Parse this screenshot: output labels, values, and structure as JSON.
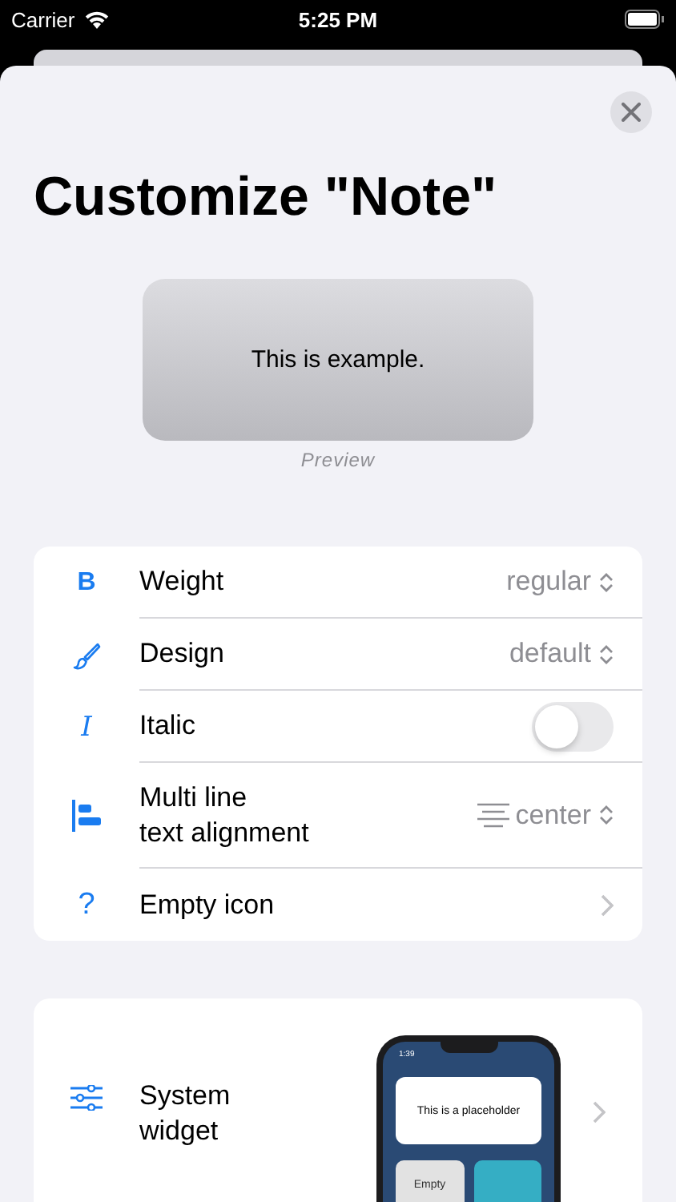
{
  "status_bar": {
    "carrier": "Carrier",
    "time": "5:25 PM"
  },
  "sheet": {
    "title": "Customize \"Note\"",
    "preview": {
      "text": "This is example.",
      "caption": "Preview"
    }
  },
  "settings": [
    {
      "kind": "picker",
      "glyph": "B",
      "label": "Weight",
      "value": "regular"
    },
    {
      "kind": "picker",
      "label": "Design",
      "value": "default"
    },
    {
      "kind": "toggle",
      "glyph": "I",
      "label": "Italic",
      "on": false
    },
    {
      "kind": "alignment",
      "label": "Multi line\ntext alignment",
      "value": "center"
    },
    {
      "kind": "link",
      "glyph": "?",
      "label": "Empty icon"
    }
  ],
  "widget_card": {
    "label": "System\nwidget",
    "phone": {
      "time": "1:39",
      "placeholder": "This is a placeholder",
      "tile": "Empty"
    }
  }
}
